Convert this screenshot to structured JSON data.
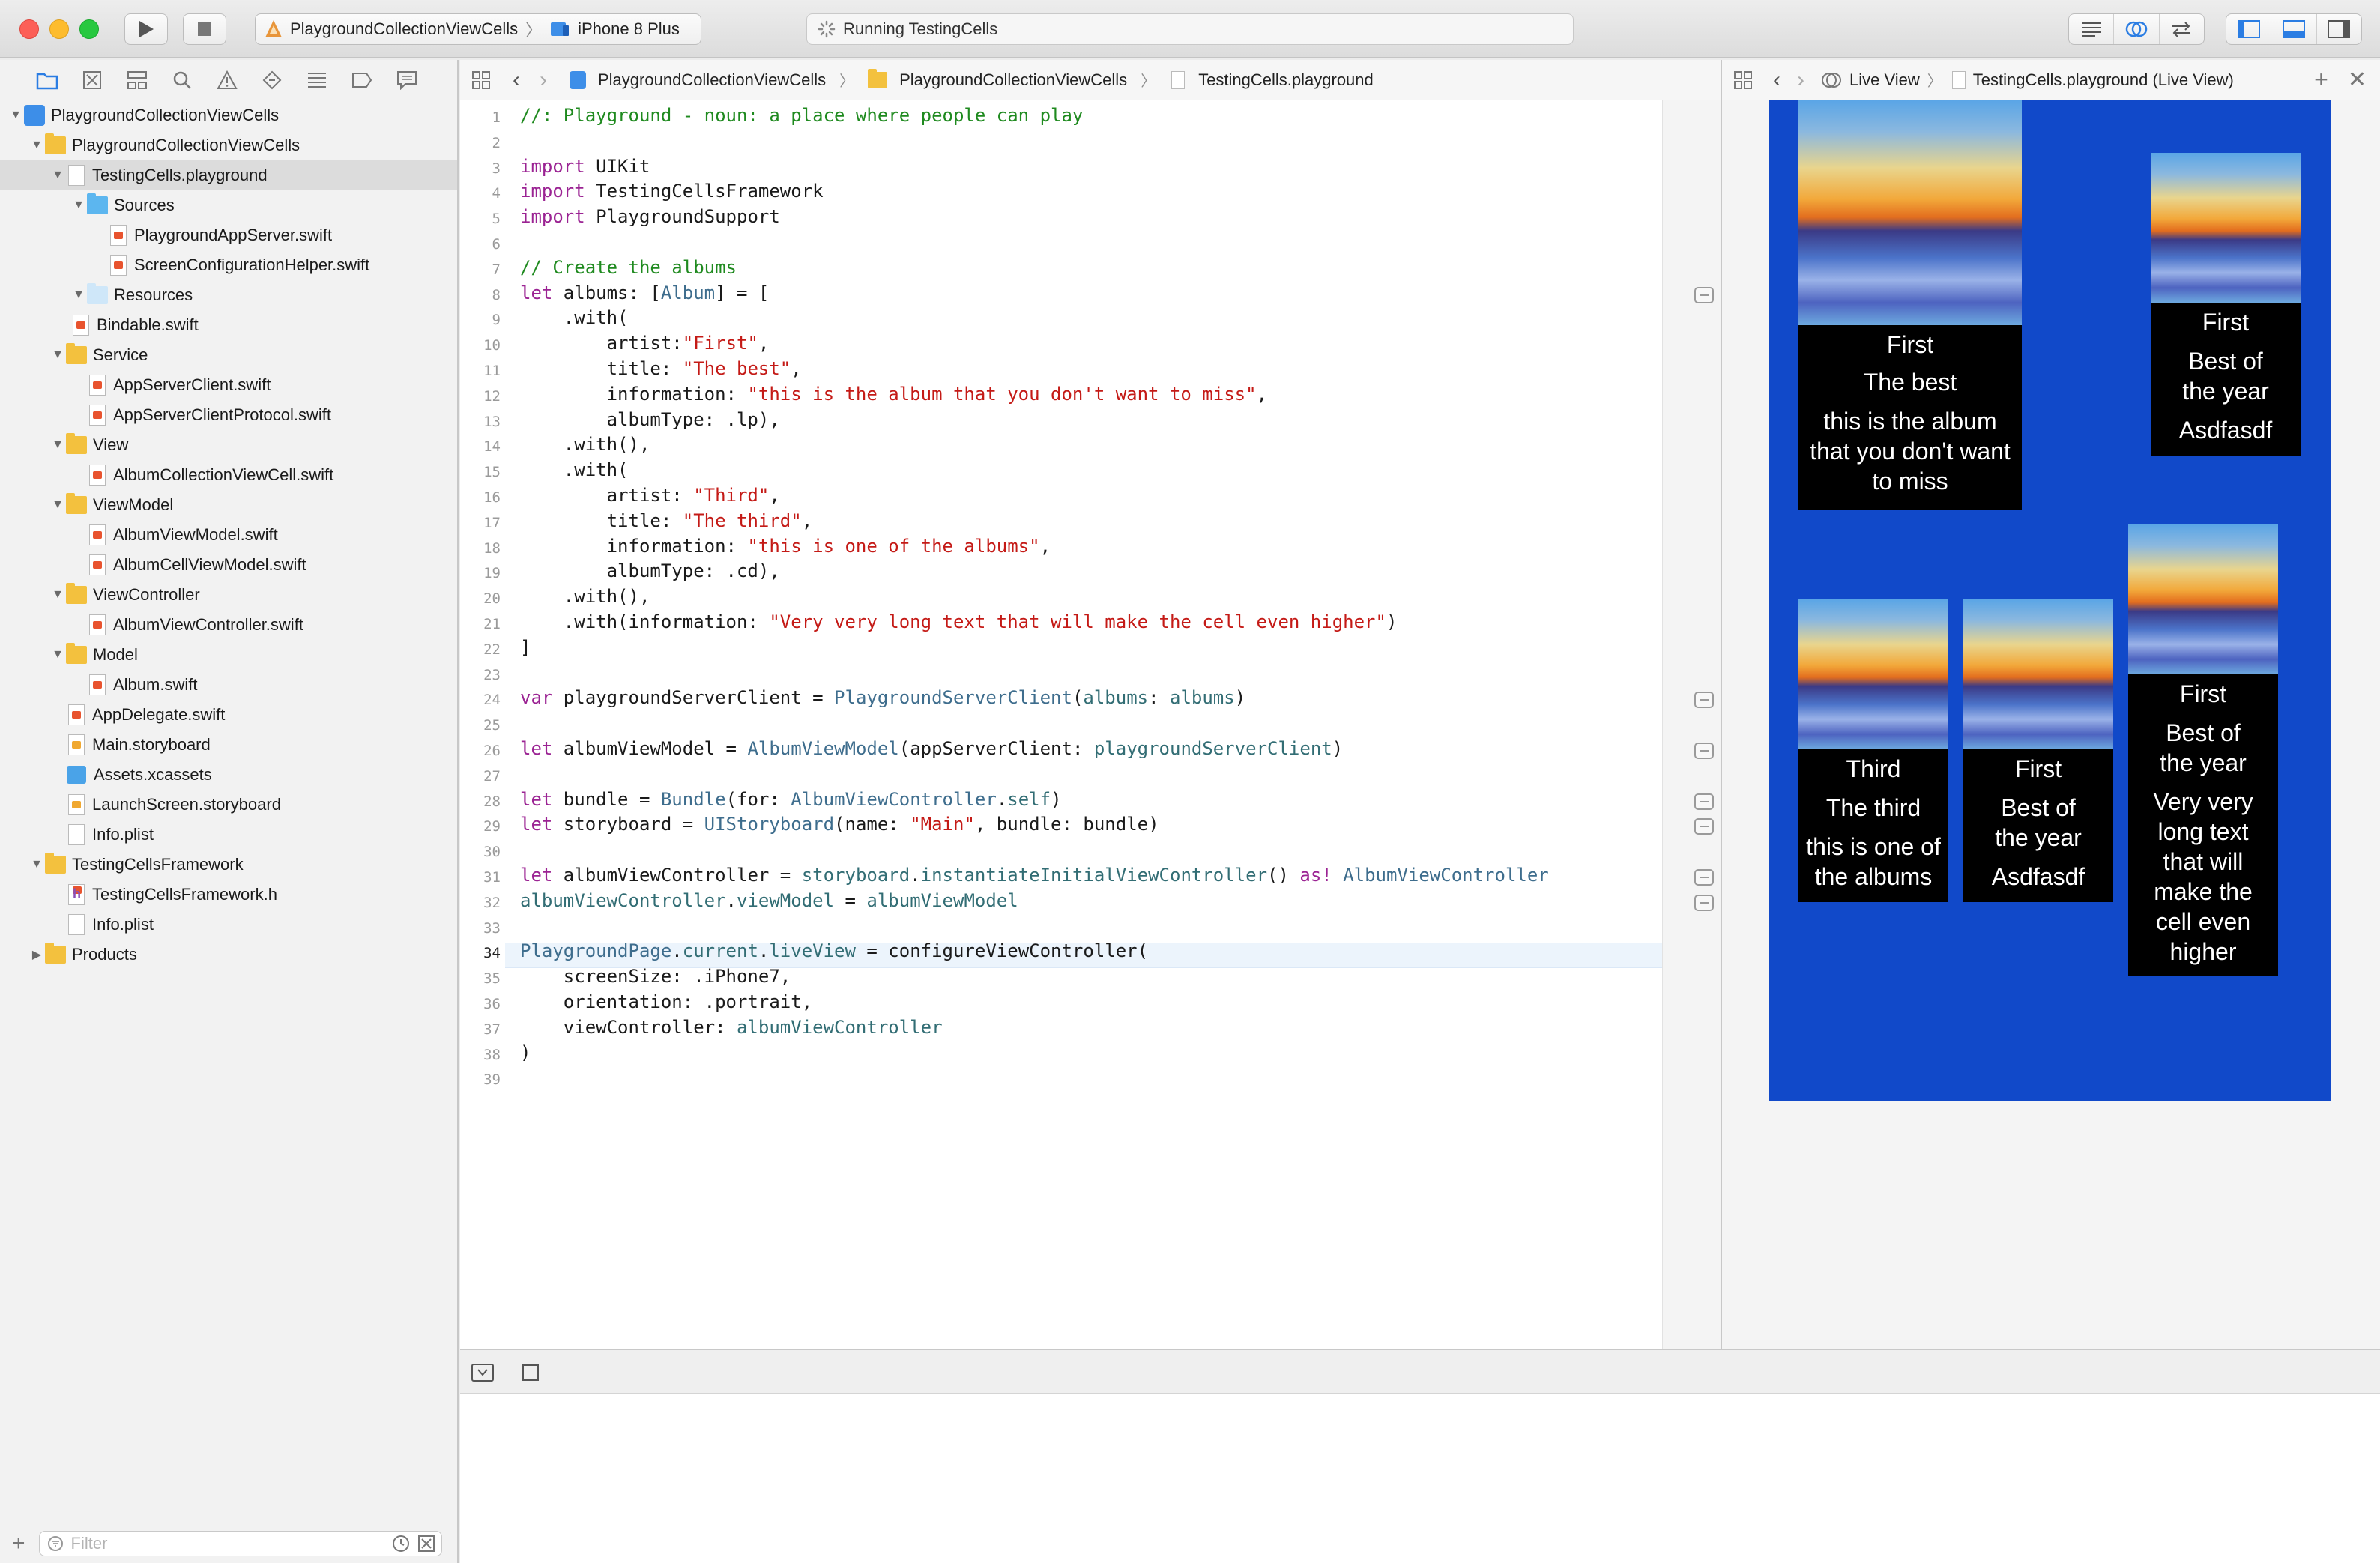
{
  "toolbar": {
    "scheme_target": "PlaygroundCollectionViewCells",
    "scheme_device": "iPhone 8 Plus",
    "status": "Running TestingCells"
  },
  "navigator": {
    "items": [
      {
        "label": "PlaygroundCollectionViewCells",
        "icon": "project-icon",
        "level": 0
      },
      {
        "label": "PlaygroundCollectionViewCells",
        "icon": "folder-icon",
        "level": 1
      },
      {
        "label": "TestingCells.playground",
        "icon": "playground-file-icon",
        "level": 2
      },
      {
        "label": "Sources",
        "icon": "blue-folder-icon",
        "level": 3
      },
      {
        "label": "PlaygroundAppServer.swift",
        "icon": "swift-file-icon",
        "level": 4
      },
      {
        "label": "ScreenConfigurationHelper.swift",
        "icon": "swift-file-icon",
        "level": 4
      },
      {
        "label": "Resources",
        "icon": "folder-icon",
        "level": 3
      },
      {
        "label": "Bindable.swift",
        "icon": "swift-file-icon",
        "level": 3
      },
      {
        "label": "Service",
        "icon": "folder-icon",
        "level": 2
      },
      {
        "label": "AppServerClient.swift",
        "icon": "swift-file-icon",
        "level": 3
      },
      {
        "label": "AppServerClientProtocol.swift",
        "icon": "swift-file-icon",
        "level": 3
      },
      {
        "label": "View",
        "icon": "folder-icon",
        "level": 2
      },
      {
        "label": "AlbumCollectionViewCell.swift",
        "icon": "swift-file-icon",
        "level": 3
      },
      {
        "label": "ViewModel",
        "icon": "folder-icon",
        "level": 2
      },
      {
        "label": "AlbumViewModel.swift",
        "icon": "swift-file-icon",
        "level": 3
      },
      {
        "label": "AlbumCellViewModel.swift",
        "icon": "swift-file-icon",
        "level": 3
      },
      {
        "label": "ViewController",
        "icon": "folder-icon",
        "level": 2
      },
      {
        "label": "AlbumViewController.swift",
        "icon": "swift-file-icon",
        "level": 3
      },
      {
        "label": "Model",
        "icon": "folder-icon",
        "level": 2
      },
      {
        "label": "Album.swift",
        "icon": "swift-file-icon",
        "level": 3
      },
      {
        "label": "AppDelegate.swift",
        "icon": "swift-file-icon",
        "level": 2
      },
      {
        "label": "Main.storyboard",
        "icon": "storyboard-file-icon",
        "level": 2
      },
      {
        "label": "Assets.xcassets",
        "icon": "assets-icon",
        "level": 2
      },
      {
        "label": "LaunchScreen.storyboard",
        "icon": "storyboard-file-icon",
        "level": 2
      },
      {
        "label": "Info.plist",
        "icon": "plist-file-icon",
        "level": 2
      },
      {
        "label": "TestingCellsFramework",
        "icon": "folder-icon",
        "level": 1
      },
      {
        "label": "TestingCellsFramework.h",
        "icon": "header-file-icon",
        "level": 2
      },
      {
        "label": "Info.plist",
        "icon": "plist-file-icon",
        "level": 2
      },
      {
        "label": "Products",
        "icon": "folder-icon",
        "level": 1
      }
    ],
    "filter_placeholder": "Filter"
  },
  "editor_jumpbar": {
    "crumbs": [
      "PlaygroundCollectionViewCells",
      "PlaygroundCollectionViewCells",
      "TestingCells.playground"
    ]
  },
  "assistant_jumpbar": {
    "mode": "Live View",
    "file": "TestingCells.playground (Live View)"
  },
  "editor": {
    "current_line": 34,
    "lines": [
      "//: Playground - noun: a place where people can play",
      "",
      "import UIKit",
      "import TestingCellsFramework",
      "import PlaygroundSupport",
      "",
      "// Create the albums",
      "let albums: [Album] = [",
      "    .with(",
      "        artist:\"First\",",
      "        title: \"The best\",",
      "        information: \"this is the album that you don't want to miss\",",
      "        albumType: .lp),",
      "    .with(),",
      "    .with(",
      "        artist: \"Third\",",
      "        title: \"The third\",",
      "        information: \"this is one of the albums\",",
      "        albumType: .cd),",
      "    .with(),",
      "    .with(information: \"Very very long text that will make the cell even higher\")",
      "]",
      "",
      "var playgroundServerClient = PlaygroundServerClient(albums: albums)",
      "",
      "let albumViewModel = AlbumViewModel(appServerClient: playgroundServerClient)",
      "",
      "let bundle = Bundle(for: AlbumViewController.self)",
      "let storyboard = UIStoryboard(name: \"Main\", bundle: bundle)",
      "",
      "let albumViewController = storyboard.instantiateInitialViewController() as! AlbumViewController",
      "albumViewController.viewModel = albumViewModel",
      "",
      "PlaygroundPage.current.liveView = configureViewController(",
      "    screenSize: .iPhone7,",
      "    orientation: .portrait,",
      "    viewController: albumViewController",
      ")",
      ""
    ],
    "result_markers_on_lines": [
      8,
      24,
      26,
      28,
      29,
      31,
      32
    ]
  },
  "live_view": {
    "background": "#1149c9",
    "cells": [
      {
        "lines": [
          "First",
          "The best",
          "this is the album",
          "that you don't want",
          "to miss"
        ]
      },
      {
        "lines": [
          "First",
          "Best of",
          "the year",
          "Asdfasdf"
        ]
      },
      {
        "lines": [
          "Third",
          "The third",
          "this is one of",
          "the albums"
        ]
      },
      {
        "lines": [
          "First",
          "Best of",
          "the year",
          "Asdfasdf"
        ]
      },
      {
        "lines": [
          "First",
          "Best of",
          "the year",
          "Very very",
          "long text",
          "that will",
          "make the",
          "cell even",
          "higher"
        ]
      }
    ]
  }
}
